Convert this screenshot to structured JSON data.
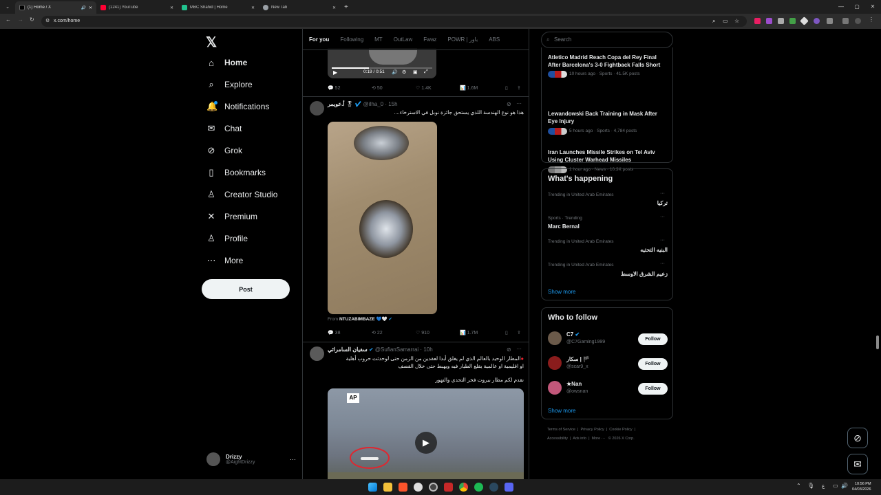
{
  "browser": {
    "tabs": [
      {
        "title": "(1) Home / X",
        "color": "#ffffff"
      },
      {
        "title": "(1241) YouTube",
        "color": "#ff0033"
      },
      {
        "title": "MBC Shahid | Home",
        "color": "#21c28e"
      },
      {
        "title": "New Tab",
        "color": "#9aa0a6"
      }
    ],
    "url": "x.com/home"
  },
  "sidebar": {
    "items": [
      {
        "label": "Home",
        "icon": "home-icon",
        "glyph": "⌂"
      },
      {
        "label": "Explore",
        "icon": "search-icon",
        "glyph": "⌕"
      },
      {
        "label": "Notifications",
        "icon": "bell-icon",
        "glyph": "♫"
      },
      {
        "label": "Chat",
        "icon": "mail-icon",
        "glyph": "✉"
      },
      {
        "label": "Grok",
        "icon": "grok-icon",
        "glyph": "⊘"
      },
      {
        "label": "Bookmarks",
        "icon": "bookmark-icon",
        "glyph": "▯"
      },
      {
        "label": "Creator Studio",
        "icon": "creator-icon",
        "glyph": "♙"
      },
      {
        "label": "Premium",
        "icon": "x-icon",
        "glyph": "✕"
      },
      {
        "label": "Profile",
        "icon": "person-icon",
        "glyph": "♙"
      },
      {
        "label": "More",
        "icon": "more-icon",
        "glyph": "⋯"
      }
    ],
    "post_label": "Post",
    "account": {
      "name": "Drizzy",
      "handle": "@AightDrizzy"
    }
  },
  "feed": {
    "tabs": [
      "For you",
      "Following",
      "MT",
      "OutLaw",
      "Fwaz",
      "POWR | باور",
      "ABS"
    ],
    "video_time": "0:19 / 0:51",
    "tweet0_stats": {
      "replies": "52",
      "reposts": "50",
      "likes": "1.4K",
      "views": "1.6M"
    },
    "tweet1": {
      "name": "أ.عويمر",
      "handle": "@ilha_0",
      "time": "15h",
      "text": "هذا هو نوع الهندسة اللذي يستحق جائزة نوبل في الاسترخاء....",
      "from_label": "From",
      "from_name": "NTUZABIMBAZE",
      "stats": {
        "replies": "38",
        "reposts": "22",
        "likes": "910",
        "views": "1.7M"
      }
    },
    "tweet2": {
      "name": "سفيان السامرائي",
      "handle": "@SufianSamarrai",
      "time": "10h",
      "line1": "المطار الوحيد بالعالم الذي لم يغلق أبدا لعقدين من الزمن حتى لوحدثت حروب أهلية",
      "line2": "او اقليمية او عالمية يقلع الطيار فيه ويهبط حتى خلال القصف",
      "line3": "نقدم لكم مطار بيروت فخر التحدي والتهور",
      "badge": "AP"
    }
  },
  "rightcol": {
    "search_placeholder": "Search",
    "news": [
      {
        "title": "Atletico Madrid Reach Copa del Rey Final After Barcelona's 3-0 Fightback Falls Short",
        "meta": "10 hours ago · Sports · 41.5K posts"
      },
      {
        "title": "Lewandowski Back Training in Mask After Eye Injury",
        "meta": "5 hours ago · Sports · 4,784 posts"
      },
      {
        "title": "Iran Launches Missile Strikes on Tel Aviv Using Cluster Warhead Missiles",
        "meta": "1 hour ago · News · 10.3K posts"
      }
    ],
    "happening_title": "What's happening",
    "trends": [
      {
        "context": "Trending in United Arab Emirates",
        "name": "تركيا"
      },
      {
        "context": "Sports · Trending",
        "name": "Marc Bernal"
      },
      {
        "context": "Trending in United Arab Emirates",
        "name": "البنيه التحتيه"
      },
      {
        "context": "Trending in United Arab Emirates",
        "name": "زعيم الشرق الاوسط"
      }
    ],
    "show_more": "Show more",
    "follow_title": "Who to follow",
    "follow": [
      {
        "name": "C7",
        "handle": "@C7Gaming1999",
        "btn": "Follow"
      },
      {
        "name": "سكار | 🏴",
        "handle": "@scar9_x",
        "btn": "Follow"
      },
      {
        "name": "★Nan",
        "handle": "@owsnan",
        "btn": "Follow"
      }
    ],
    "footer1": [
      "Terms of Service",
      "Privacy Policy",
      "Cookie Policy"
    ],
    "footer2": [
      "Accessibility",
      "Ads info",
      "More ···",
      "© 2026 X Corp."
    ]
  },
  "taskbar": {
    "time": "10:56 PM",
    "date": "04/03/2026",
    "lang": "ع"
  }
}
